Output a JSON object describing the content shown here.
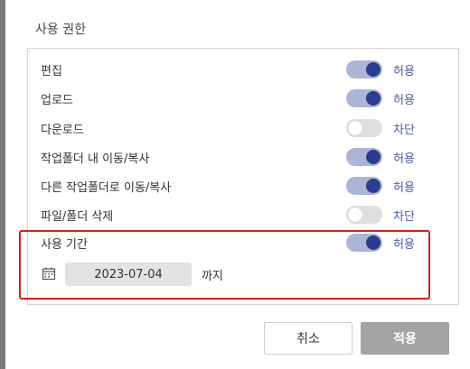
{
  "section_title": "사용 권한",
  "permissions": [
    {
      "label": "편집",
      "enabled": true,
      "state": "허용"
    },
    {
      "label": "업로드",
      "enabled": true,
      "state": "허용"
    },
    {
      "label": "다운로드",
      "enabled": false,
      "state": "차단"
    },
    {
      "label": "작업폴더 내 이동/복사",
      "enabled": true,
      "state": "허용"
    },
    {
      "label": "다른 작업폴더로 이동/복사",
      "enabled": true,
      "state": "허용"
    },
    {
      "label": "파일/폴더 삭제",
      "enabled": false,
      "state": "차단"
    }
  ],
  "usage_period": {
    "label": "사용 기간",
    "enabled": true,
    "state": "허용",
    "date": "2023-07-04",
    "until": "까지"
  },
  "buttons": {
    "cancel": "취소",
    "apply": "적용"
  },
  "colors": {
    "toggle_on_track": "#aeb4d4",
    "toggle_on_knob": "#2c3d8f",
    "toggle_off_track": "#dedede",
    "state_text": "#4a5aa3",
    "highlight": "#e21b1b",
    "apply_button": "#a3a3a3"
  },
  "icons": {
    "date": "calendar-icon"
  }
}
